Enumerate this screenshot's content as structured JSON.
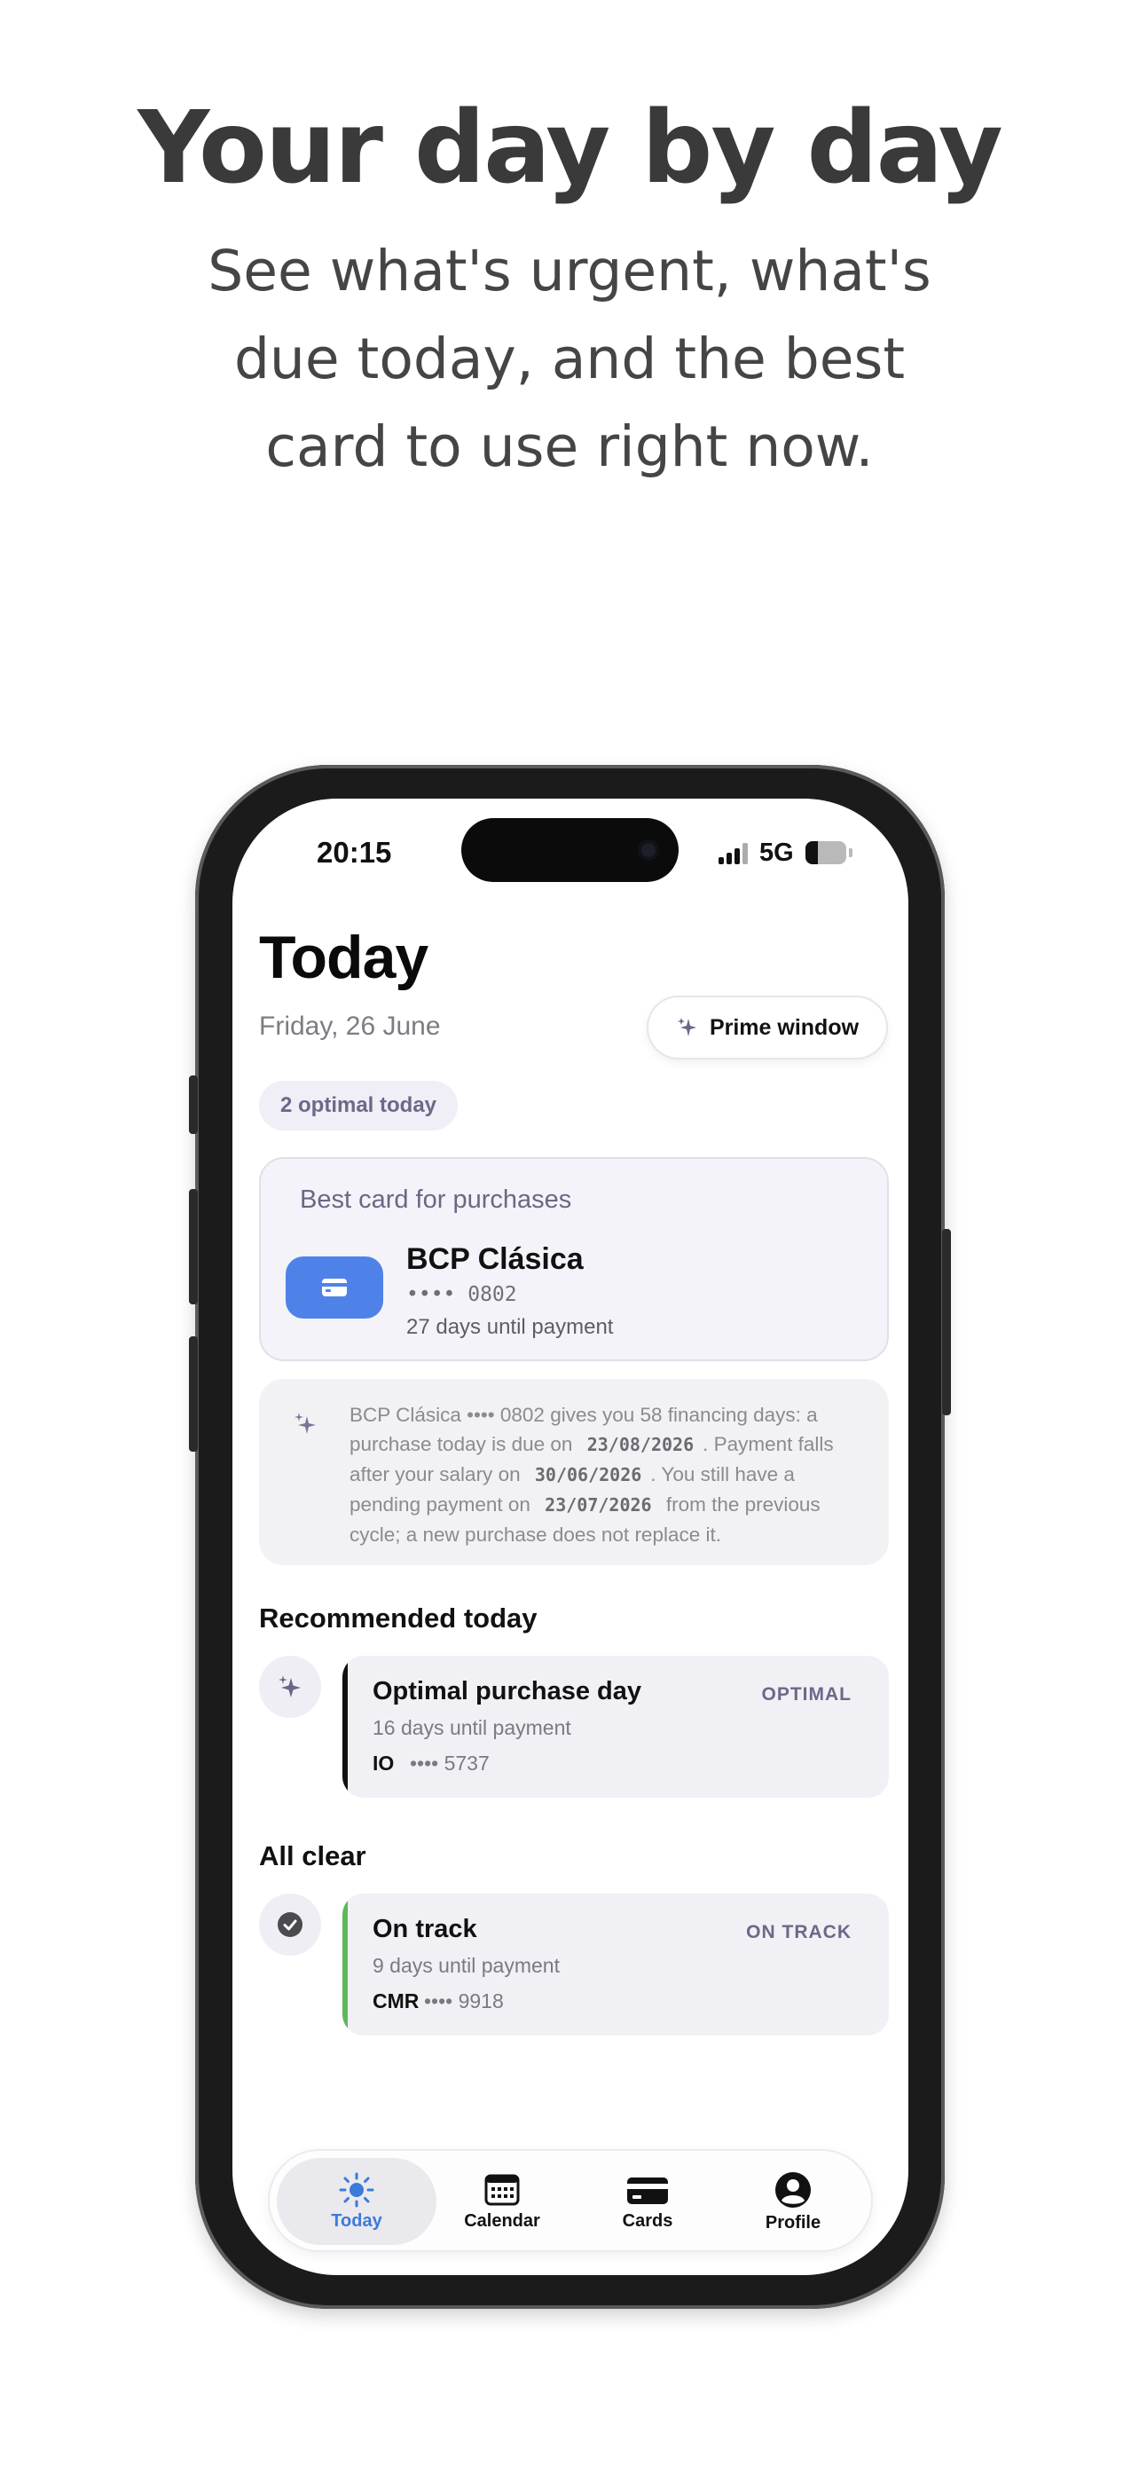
{
  "hero": {
    "title": "Your day by day",
    "subtitle": "See what's urgent, what's due today, and the best card to use right now."
  },
  "status_bar": {
    "time": "20:15",
    "network": "5G",
    "battery_level": 0.3
  },
  "today": {
    "title": "Today",
    "date": "Friday, 26 June",
    "prime_button": "Prime window",
    "chip": "2 optimal today"
  },
  "best_card": {
    "label": "Best card for purchases",
    "name": "BCP Clásica",
    "masked_number": "•••• 0802",
    "days": "27 days until payment",
    "accent_color": "#4f82e8"
  },
  "insight": {
    "part1": "BCP Clásica •••• 0802 gives you 58 financing days: a purchase today is due on",
    "date1": "23/08/2026",
    "part2": ". Payment falls after your salary on",
    "date2": "30/06/2026",
    "part3": ". You still have a pending payment on",
    "date3": "23/07/2026",
    "part4": "from the previous cycle; a new purchase does not replace it."
  },
  "recommended": {
    "heading": "Recommended today",
    "items": [
      {
        "title": "Optimal purchase day",
        "badge": "OPTIMAL",
        "days": "16 days until payment",
        "bank": "IO",
        "mask": "•••• 5737",
        "bar_color": "#111111",
        "icon": "sparkle-icon"
      }
    ]
  },
  "all_clear": {
    "heading": "All clear",
    "items": [
      {
        "title": "On track",
        "badge": "ON TRACK",
        "days": "9 days until payment",
        "bank": "CMR",
        "mask": "•••• 9918",
        "bar_color": "#5cb85c",
        "icon": "check-circle-icon"
      }
    ]
  },
  "tabbar": {
    "items": [
      {
        "label": "Today",
        "icon": "sun-icon",
        "active": true
      },
      {
        "label": "Calendar",
        "icon": "calendar-icon",
        "active": false
      },
      {
        "label": "Cards",
        "icon": "card-icon",
        "active": false
      },
      {
        "label": "Profile",
        "icon": "profile-icon",
        "active": false
      }
    ],
    "accent_color": "#3c7ad9"
  }
}
